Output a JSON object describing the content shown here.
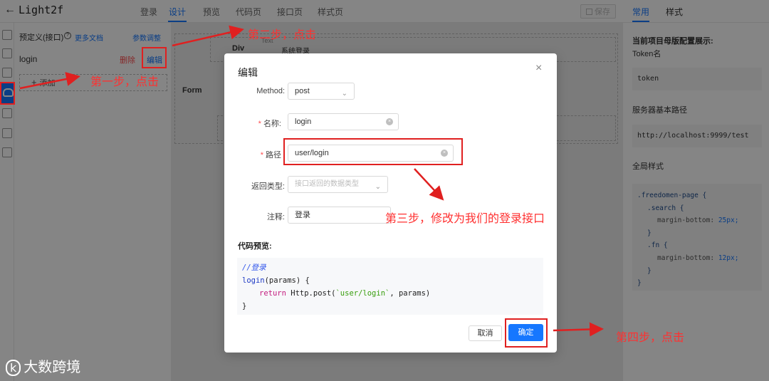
{
  "app": {
    "back_glyph": "←",
    "title": "Light2f",
    "tabs": [
      "登录",
      "设计",
      "预览",
      "代码页",
      "接口页",
      "样式页"
    ],
    "save_label": "保存"
  },
  "left_panel": {
    "title": "预定义(接口)",
    "more_docs": "更多文档",
    "param_adjust": "参数调整",
    "item_name": "login",
    "delete_label": "删除",
    "edit_label": "编辑",
    "add_label": "添加"
  },
  "canvas": {
    "div_label": "Div",
    "form_label": "Form",
    "system_login": "系统登录",
    "text_tag": "Text"
  },
  "right_panel": {
    "tabs": [
      "常用",
      "样式"
    ],
    "config_title": "当前项目母版配置展示:",
    "token_label": "Token名",
    "token_value": "token",
    "base_path_label": "服务器基本路径",
    "base_path_value": "http://localhost:9999/test",
    "global_style_label": "全局样式",
    "css": {
      "l1": ".freedomen-page {",
      "l2": ".search {",
      "l3_prop": "margin-bottom:",
      "l3_val": "25px;",
      "l4": "}",
      "l5": ".fn {",
      "l6_prop": "margin-bottom:",
      "l6_val": "12px;",
      "l7": "}",
      "l8": "}"
    }
  },
  "modal": {
    "title": "编辑",
    "close_glyph": "×",
    "method_label": "Method:",
    "method_value": "post",
    "name_label": "名称:",
    "name_value": "login",
    "path_label": "路径",
    "path_value": "user/login",
    "return_type_label": "返回类型:",
    "return_type_placeholder": "接口返回的数据类型",
    "comment_label": "注释:",
    "comment_value": "登录",
    "preview_title": "代码预览:",
    "code": {
      "comment": "//登录",
      "fn_name": "login",
      "fn_params": "(params) {",
      "ret_kw": "return",
      "ret_call": " Http.post(",
      "ret_str": "`user/login`",
      "ret_end": ", params)",
      "close": "}"
    },
    "cancel_label": "取消",
    "ok_label": "确定"
  },
  "annotations": {
    "step1": "第一步，点击",
    "step2": "第二步，点击",
    "step3": "第三步，修改为我们的登录接口",
    "step4": "第四步，点击"
  },
  "watermark": {
    "logo": "k",
    "text": "大数跨境"
  }
}
